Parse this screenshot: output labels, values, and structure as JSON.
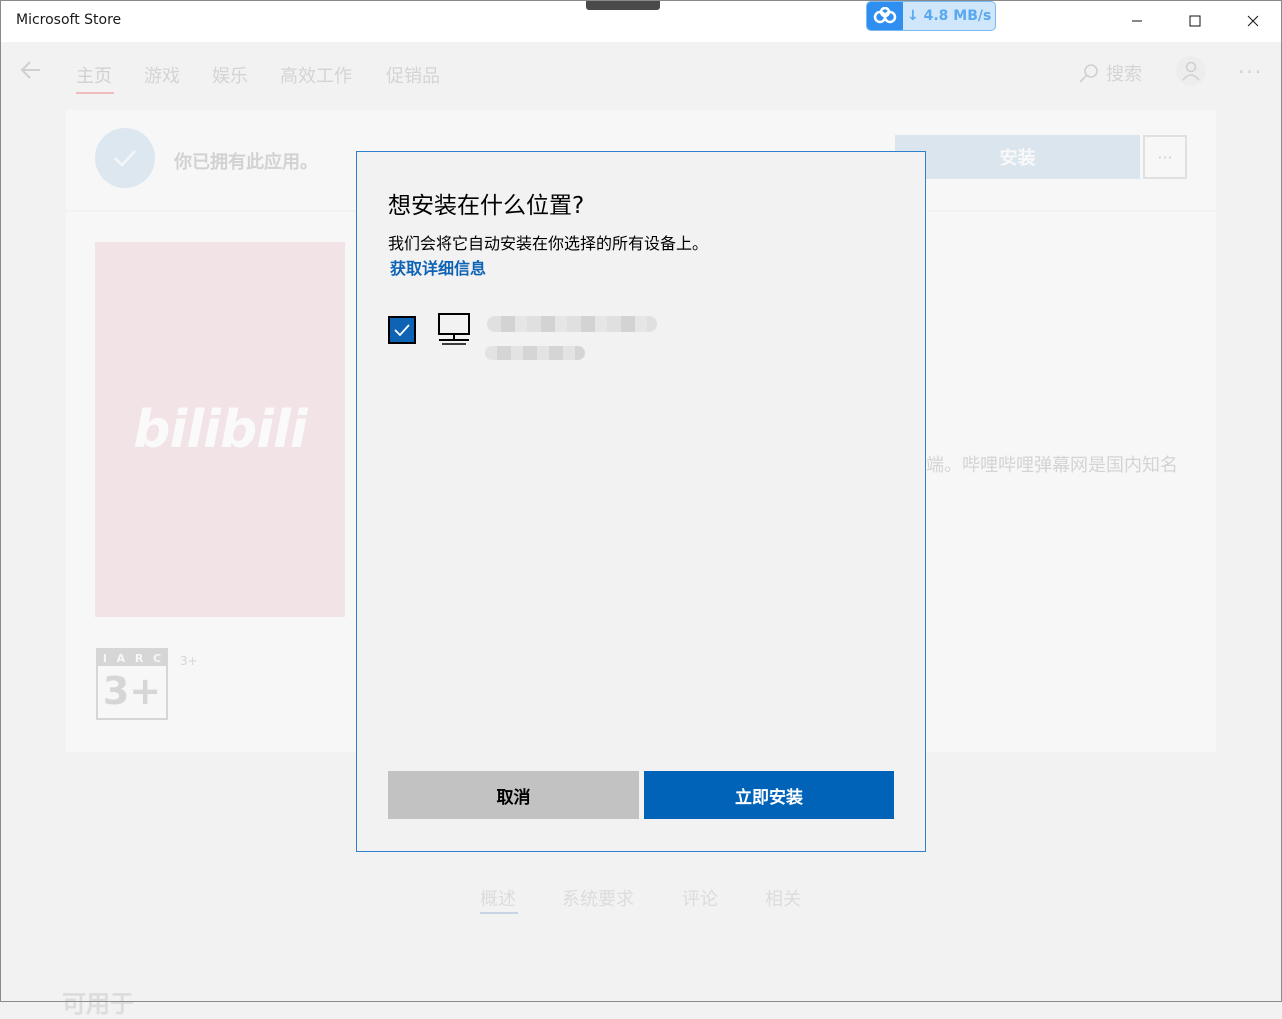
{
  "window": {
    "title": "Microsoft Store",
    "download_speed": "4.8 MB/s"
  },
  "nav": {
    "tabs": [
      "主页",
      "游戏",
      "娱乐",
      "高效工作",
      "促销品"
    ],
    "active_tab": "主页",
    "search_label": "搜索"
  },
  "product": {
    "owned_message": "你已拥有此应用。",
    "install_label": "安装",
    "more_label": "···",
    "tile_logo": "bilibili",
    "rating_board": [
      "I",
      "A",
      "R",
      "C"
    ],
    "rating_value": "3+",
    "rating_small": "3+",
    "description_fragment": "端。哔哩哔哩弹幕网是国内知名",
    "section_tabs": [
      "概述",
      "系统要求",
      "评论",
      "相关"
    ],
    "available_on": "可用于"
  },
  "dialog": {
    "title": "想安装在什么位置?",
    "subtitle": "我们会将它自动安装在你选择的所有设备上。",
    "link": "获取详细信息",
    "device_checked": true,
    "cancel_label": "取消",
    "install_label": "立即安装"
  },
  "colors": {
    "accent": "#0063b8",
    "link": "#0f63b5",
    "cancel_bg": "#c2c2c2",
    "dialog_border": "#2f7fcf"
  }
}
